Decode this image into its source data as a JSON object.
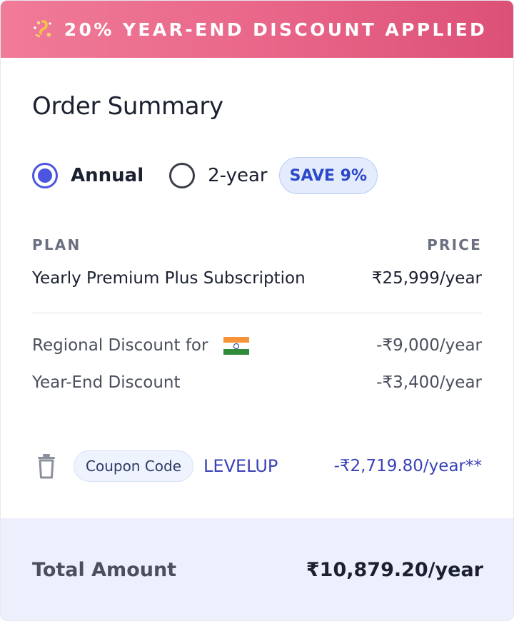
{
  "banner": {
    "text": "20% YEAR-END DISCOUNT APPLIED",
    "icon": "sparkle-confetti-icon",
    "gradient": [
      "#f07b98",
      "#dc5077"
    ]
  },
  "order": {
    "title": "Order Summary"
  },
  "billing": {
    "options": [
      {
        "label": "Annual",
        "selected": true
      },
      {
        "label": "2-year",
        "selected": false
      }
    ],
    "save_badge": "SAVE 9%"
  },
  "table": {
    "plan_header": "PLAN",
    "price_header": "PRICE",
    "plan_name": "Yearly Premium Plus Subscription",
    "plan_price": "₹25,999/year",
    "regional_label": "Regional Discount for",
    "regional_flag": "india-flag-icon",
    "regional_value": "-₹9,000/year",
    "yearend_label": "Year-End Discount",
    "yearend_value": "-₹3,400/year"
  },
  "coupon": {
    "chip_label": "Coupon Code",
    "code": "LEVELUP",
    "value": "-₹2,719.80/year**",
    "remove_icon": "trash-icon"
  },
  "total": {
    "label": "Total Amount",
    "value": "₹10,879.20/year"
  },
  "colors": {
    "accent": "#4b55e0",
    "coupon_text": "#3a42b8",
    "total_bg": "#eeeffd"
  }
}
